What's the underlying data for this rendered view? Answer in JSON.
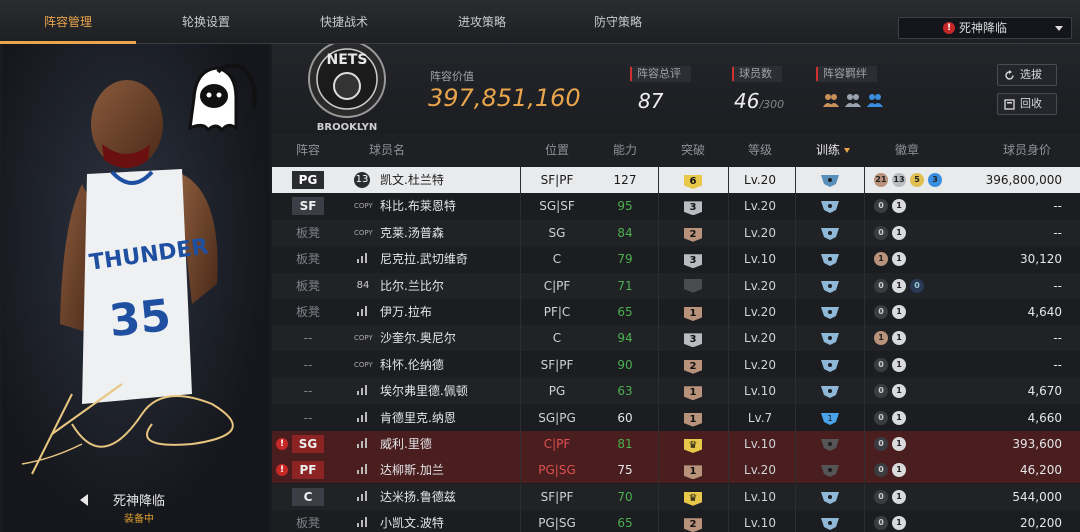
{
  "nav": {
    "tabs": [
      "阵容管理",
      "轮换设置",
      "快捷战术",
      "进攻策略",
      "防守策略"
    ],
    "active_index": 0,
    "team_select": "死神降临"
  },
  "player_card": {
    "name": "死神降临",
    "status": "装备中",
    "jersey_number": "35",
    "jersey_team": "THUNDER"
  },
  "team_logo": {
    "text_top": "NETS",
    "text_bottom": "BROOKLYN"
  },
  "lineup": {
    "value_label": "阵容价值",
    "value": "397,851,160",
    "rating_label": "阵容总评",
    "rating": "87",
    "count_label": "球员数",
    "count": "46",
    "count_max": "/300",
    "chemistry_label": "阵容羁绊"
  },
  "buttons": {
    "pick": "选拔",
    "recycle": "回收"
  },
  "table": {
    "headers": [
      "阵容",
      "球员名",
      "位置",
      "能力",
      "突破",
      "等级",
      "训练",
      "徽章",
      "球员身价"
    ],
    "sorted_column": "训练",
    "rows": [
      {
        "slot": "PG",
        "slot_type": "starter",
        "icon": "13",
        "name": "凯文.杜兰特",
        "pos": "SF|PF",
        "ability": "127",
        "break": "6",
        "break_color": "#e8c84a",
        "level": "Lv.20",
        "badge_a": "21",
        "badge_b": "13",
        "badge_c": "5",
        "badge_d": "3",
        "value": "396,800,000",
        "highlight": "selected"
      },
      {
        "slot": "SF",
        "slot_type": "starter",
        "icon": "COPY",
        "name": "科比.布莱恩特",
        "pos": "SG|SF",
        "ability": "95",
        "break": "3",
        "break_color": "#b9bcc1",
        "level": "Lv.20",
        "badge_a": "0",
        "badge_b": "1",
        "value": "--"
      },
      {
        "slot": "板凳",
        "slot_type": "bench",
        "icon": "COPY",
        "name": "克莱.汤普森",
        "pos": "SG",
        "ability": "84",
        "break": "2",
        "break_color": "#b8927a",
        "level": "Lv.20",
        "badge_a": "0",
        "badge_b": "1",
        "value": "--"
      },
      {
        "slot": "板凳",
        "slot_type": "bench",
        "icon": "bars",
        "name": "尼克拉.武切维奇",
        "pos": "C",
        "ability": "79",
        "break": "3",
        "break_color": "#b9bcc1",
        "level": "Lv.10",
        "badge_a": "1",
        "badge_b": "1",
        "value": "30,120"
      },
      {
        "slot": "板凳",
        "slot_type": "bench",
        "icon": "84",
        "name": "比尔.兰比尔",
        "pos": "C|PF",
        "ability": "71",
        "break": "",
        "break_color": "#4a4c50",
        "level": "Lv.20",
        "badge_a": "0",
        "badge_b": "1",
        "badge_c": "0",
        "value": "--"
      },
      {
        "slot": "板凳",
        "slot_type": "bench",
        "icon": "bars",
        "name": "伊万.拉布",
        "pos": "PF|C",
        "ability": "65",
        "break": "1",
        "break_color": "#b8927a",
        "level": "Lv.20",
        "badge_a": "0",
        "badge_b": "1",
        "value": "4,640"
      },
      {
        "slot": "--",
        "slot_type": "none",
        "icon": "COPY",
        "name": "沙奎尔.奥尼尔",
        "pos": "C",
        "ability": "94",
        "break": "3",
        "break_color": "#b9bcc1",
        "level": "Lv.20",
        "badge_a": "1",
        "badge_b": "1",
        "value": "--"
      },
      {
        "slot": "--",
        "slot_type": "none",
        "icon": "COPY",
        "name": "科怀.伦纳德",
        "pos": "SF|PF",
        "ability": "90",
        "break": "2",
        "break_color": "#b8927a",
        "level": "Lv.20",
        "badge_a": "0",
        "badge_b": "1",
        "value": "--"
      },
      {
        "slot": "--",
        "slot_type": "none",
        "icon": "bars",
        "name": "埃尔弗里德.佩顿",
        "pos": "PG",
        "ability": "63",
        "break": "1",
        "break_color": "#b8927a",
        "level": "Lv.10",
        "badge_a": "0",
        "badge_b": "1",
        "value": "4,670"
      },
      {
        "slot": "--",
        "slot_type": "none",
        "icon": "bars",
        "name": "肯德里克.纳恩",
        "pos": "SG|PG",
        "ability": "60",
        "break": "1",
        "break_color": "#b8927a",
        "level": "Lv.7",
        "train": "1",
        "badge_a": "0",
        "badge_b": "1",
        "value": "4,660"
      },
      {
        "slot": "SG",
        "slot_type": "alert",
        "icon": "bars",
        "name": "威利.里德",
        "pos": "C|PF",
        "ability": "81",
        "break": "crown",
        "break_color": "#e8c84a",
        "level": "Lv.10",
        "badge_a": "0",
        "badge_b": "1",
        "value": "393,600",
        "highlight": "red"
      },
      {
        "slot": "PF",
        "slot_type": "alert",
        "icon": "bars",
        "name": "达柳斯.加兰",
        "pos": "PG|SG",
        "ability": "75",
        "break": "1",
        "break_color": "#b8927a",
        "level": "Lv.20",
        "badge_a": "0",
        "badge_b": "1",
        "value": "46,200",
        "highlight": "red"
      },
      {
        "slot": "C",
        "slot_type": "starter",
        "icon": "bars",
        "name": "达米扬.鲁德兹",
        "pos": "SF|PF",
        "ability": "70",
        "break": "crown",
        "break_color": "#e8c84a",
        "level": "Lv.10",
        "badge_a": "0",
        "badge_b": "1",
        "value": "544,000"
      },
      {
        "slot": "板凳",
        "slot_type": "bench",
        "icon": "bars",
        "name": "小凯文.波特",
        "pos": "PG|SG",
        "ability": "65",
        "break": "2",
        "break_color": "#b8927a",
        "level": "Lv.10",
        "badge_a": "0",
        "badge_b": "1",
        "value": "20,200"
      }
    ]
  },
  "colors": {
    "accent": "#e8a54b",
    "alert": "#c62828",
    "green": "#4caf50"
  }
}
